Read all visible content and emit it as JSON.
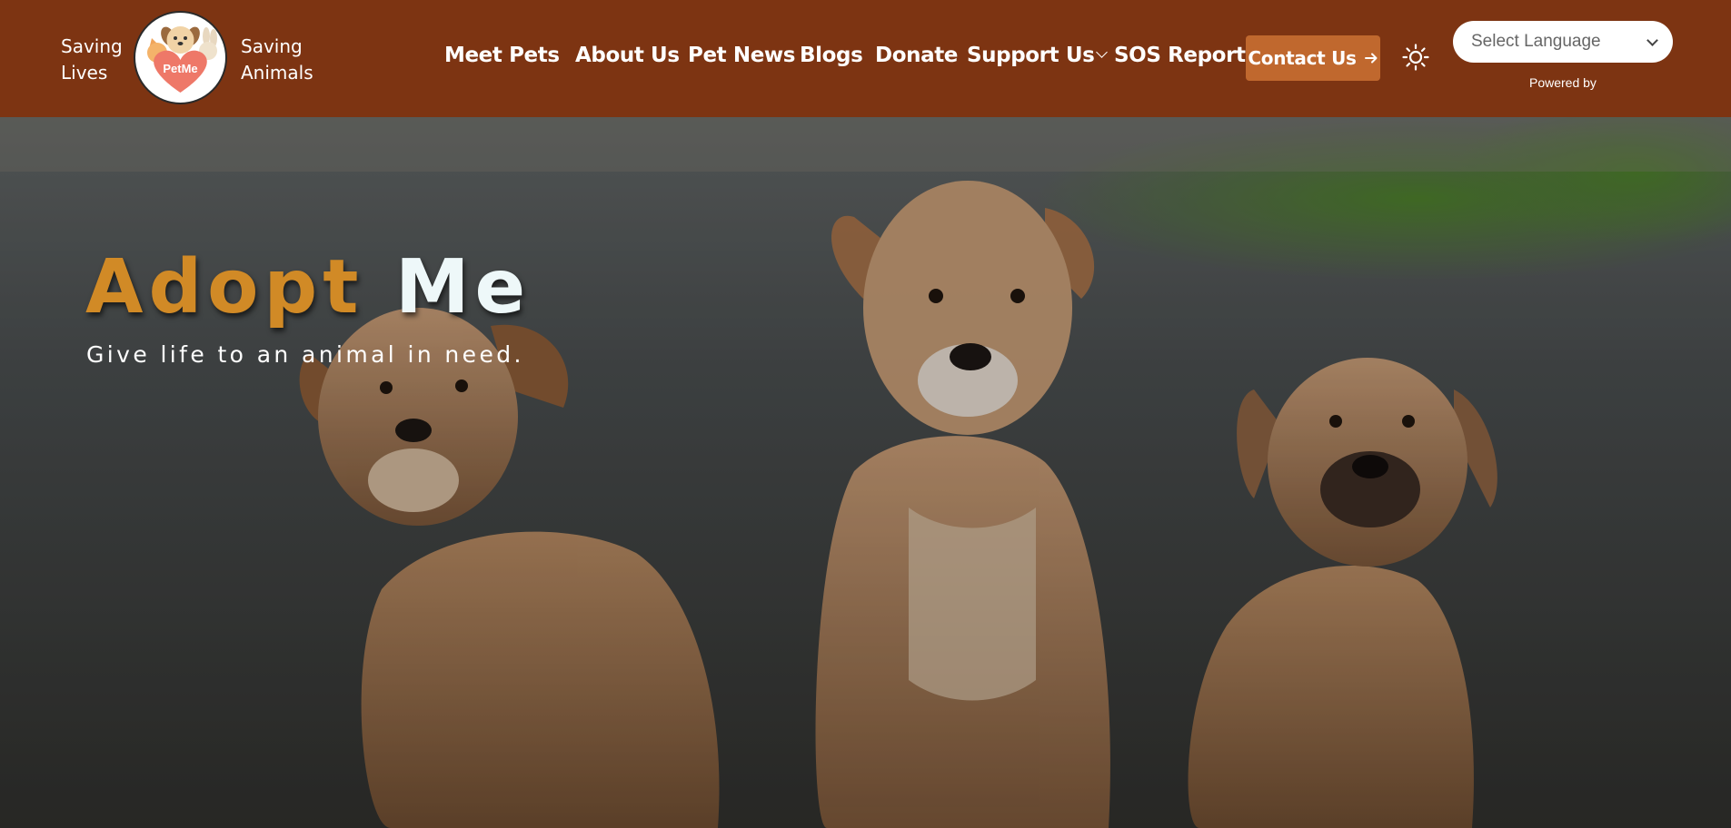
{
  "brand": {
    "tagline_left": [
      "Saving",
      "Lives"
    ],
    "tagline_right": [
      "Saving",
      "Animals"
    ],
    "logo_text": "PetMe"
  },
  "nav": {
    "items": [
      {
        "label": "Meet Pets"
      },
      {
        "label": "About Us"
      },
      {
        "label": "Pet News"
      },
      {
        "label": "Blogs"
      },
      {
        "label": "Donate"
      },
      {
        "label": "Support Us",
        "has_dropdown": true
      },
      {
        "label": "SOS Report"
      }
    ],
    "contact_button": {
      "label": "Contact Us",
      "icon": "arrow-right-icon"
    },
    "theme_toggle_icon": "sun-icon"
  },
  "language": {
    "selected": "Select Language",
    "powered_by": "Powered by"
  },
  "hero": {
    "title_word1": "Adopt",
    "title_word2": "Me",
    "subtitle": "Give life to an animal in need."
  },
  "colors": {
    "navbar_bg": "#7d3412",
    "contact_button_bg": "#c0682e",
    "hero_title_accent": "#d18a26"
  }
}
